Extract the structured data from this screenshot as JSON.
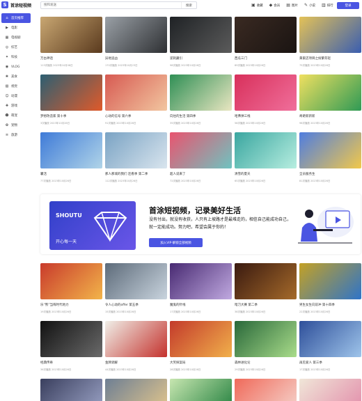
{
  "header": {
    "logo_mark": "S",
    "logo_text": "首涂短视频",
    "search_placeholder": "搜和发送",
    "search_button": "搜索",
    "links": [
      {
        "icon": "tv-icon",
        "glyph": "▣",
        "label": "收藏"
      },
      {
        "icon": "diamond-icon",
        "glyph": "◆",
        "label": "会员"
      },
      {
        "icon": "image-icon",
        "glyph": "▤",
        "label": "图片"
      },
      {
        "icon": "pen-icon",
        "glyph": "✎",
        "label": "小说"
      },
      {
        "icon": "chart-icon",
        "glyph": "▥",
        "label": "排行"
      }
    ],
    "login_label": "登录"
  },
  "sidebar": {
    "items": [
      {
        "icon": "home-icon",
        "glyph": "⌂",
        "label": "首页推荐"
      },
      {
        "icon": "film-icon",
        "glyph": "▶",
        "label": "电影"
      },
      {
        "icon": "series-icon",
        "glyph": "▦",
        "label": "电视剧"
      },
      {
        "icon": "variety-icon",
        "glyph": "◎",
        "label": "综艺"
      },
      {
        "icon": "science-icon",
        "glyph": "✦",
        "label": "科技"
      },
      {
        "icon": "vlog-icon",
        "glyph": "◉",
        "label": "VLOG"
      },
      {
        "icon": "food-icon",
        "glyph": "❀",
        "label": "美食"
      },
      {
        "icon": "film-roll-icon",
        "glyph": "▧",
        "label": "视觉"
      },
      {
        "icon": "anime-icon",
        "glyph": "☺",
        "label": "动漫"
      },
      {
        "icon": "game-icon",
        "glyph": "✚",
        "label": "游戏"
      },
      {
        "icon": "baby-icon",
        "glyph": "☻",
        "label": "萌宠"
      },
      {
        "icon": "pet-icon",
        "glyph": "✿",
        "label": "宠物"
      },
      {
        "icon": "more-icon",
        "glyph": "≡",
        "label": "旅游"
      }
    ]
  },
  "rows_top": [
    [
      {
        "title": "万古神话",
        "meta": "113次播放    2023年10月08日",
        "c1": "#c9a772",
        "c2": "#5a3a1e"
      },
      {
        "title": "异地追凶",
        "meta": "170次播放    2023年10月23日",
        "c1": "#9aa0a6",
        "c2": "#2e3033"
      },
      {
        "title": "逆刺藏引",
        "meta": "98次播放    2023年10月26日",
        "c1": "#1f2225",
        "c2": "#5b5b5b"
      },
      {
        "title": "西瓜三门",
        "meta": "89次播放    2023年10月26日",
        "c1": "#3a2a22",
        "c2": "#1a1412"
      },
      {
        "title": "黄家店项目之纷繁年轻",
        "meta": "75次播放    2023年10月26日",
        "c1": "#e4c257",
        "c2": "#3a5eb0"
      }
    ],
    [
      {
        "title": "梦想改造家 第十季",
        "meta": "3次播放    2023年10月26日",
        "c1": "#2c5f72",
        "c2": "#e05a2a"
      },
      {
        "title": "心动的信号 第六季",
        "meta": "91次播放    2023年10月26日",
        "c1": "#d75a52",
        "c2": "#f2c6a0"
      },
      {
        "title": "向往的生活 第四季",
        "meta": "35次播放    2023年10月26日",
        "c1": "#2f8f55",
        "c2": "#e9e6c1"
      },
      {
        "title": "哈弗弹三线",
        "meta": "58次播放    2023年10月26日",
        "c1": "#d8305b",
        "c2": "#f06f9b"
      },
      {
        "title": "奇葩新新新",
        "meta": "98次播放    2023年10月26日",
        "c1": "#f0e060",
        "c2": "#2f9a55"
      }
    ],
    [
      {
        "title": "囊活",
        "meta": "77次播放    2023年10月26日",
        "c1": "#3f7bd8",
        "c2": "#b0d4e8"
      },
      {
        "title": "那人那城的我们 连看季 第二季",
        "meta": "112次播放    2023年10月26日",
        "c1": "#7aa3c4",
        "c2": "#d9e5ee"
      },
      {
        "title": "超人说来了",
        "meta": "72次播放    2023年10月26日",
        "c1": "#e9546f",
        "c2": "#6fc3c0"
      },
      {
        "title": "清雪的夏天",
        "meta": "65次播放    2023年10月26日",
        "c1": "#3aa6a0",
        "c2": "#b7eee0"
      },
      {
        "title": "全员服务生",
        "meta": "81次播放    2023年10月26日",
        "c1": "#4f7de0",
        "c2": "#f1c84b"
      }
    ]
  ],
  "banner": {
    "card_title": "SHOUTU",
    "card_sub": "开心每一天",
    "heading": "首涂短视频，记录美好生活",
    "description": "没有付出，就没有收获，人只有上坡路才是最难走的，相信自己能成功自己，就一定能成功。努力吧，希望会属于你的！",
    "vip_button": "加入VIP·解锁全部视频"
  },
  "rows_bottom": [
    [
      {
        "title": "乐“熊”当嗨时代地力",
        "meta": "19次播放    2023年10月26日",
        "c1": "#c93b2c",
        "c2": "#f2b44a"
      },
      {
        "title": "令人心动的offer 第五季",
        "meta": "15次播放    2023年10月26日",
        "c1": "#5d6b7a",
        "c2": "#c9d4de"
      },
      {
        "title": "魔鬼的针线",
        "meta": "17次播放    2023年10月26日",
        "c1": "#482a72",
        "c2": "#c0a9e0"
      },
      {
        "title": "暗刀大赛 第二季",
        "meta": "38次播放    2023年10月26日",
        "c1": "#3a1a10",
        "c2": "#a56a2a"
      },
      {
        "title": "男生女生向前冲 第十四季",
        "meta": "22次播放    2023年10月26日",
        "c1": "#c3a125",
        "c2": "#2f74c8"
      }
    ],
    [
      {
        "title": "经典传奇",
        "meta": "36次播放    2023年10月26日",
        "c1": "#121212",
        "c2": "#6a6a6a"
      },
      {
        "title": "金牌调解",
        "meta": "44次播放    2023年10月26日",
        "c1": "#f0efe8",
        "c2": "#c4312c"
      },
      {
        "title": "大笑探案局",
        "meta": "28次播放    2023年10月26日",
        "c1": "#c33a2b",
        "c2": "#f1b04b"
      },
      {
        "title": "森林进化论",
        "meta": "29次播放    2023年10月26日",
        "c1": "#29683a",
        "c2": "#a9dc8a"
      },
      {
        "title": "再见爱人 第三季",
        "meta": "17次播放    2023年10月26日",
        "c1": "#2e4f9a",
        "c2": "#9ec4ea"
      }
    ],
    [
      {
        "title": "",
        "meta": "",
        "c1": "#3a3f5e",
        "c2": "#9ea6c9"
      },
      {
        "title": "",
        "meta": "",
        "c1": "#6e7f94",
        "c2": "#e7c98c"
      },
      {
        "title": "",
        "meta": "",
        "c1": "#c7e6b0",
        "c2": "#1e7d3b"
      },
      {
        "title": "",
        "meta": "",
        "c1": "#f06a5a",
        "c2": "#f5d7d0"
      },
      {
        "title": "",
        "meta": "",
        "c1": "#f0e6d8",
        "c2": "#e28aa9"
      }
    ]
  ]
}
